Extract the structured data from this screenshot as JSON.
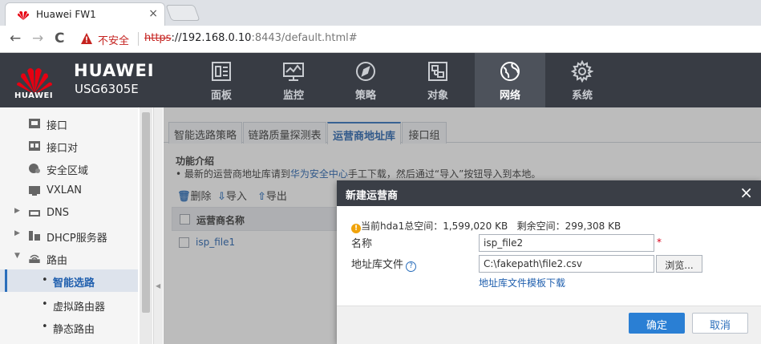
{
  "browser": {
    "tab_title": "Huawei FW1",
    "tab_close": "×",
    "back": "←",
    "forward": "→",
    "reload": "C",
    "insecure_label": "不安全",
    "url_scheme": "https",
    "url_host": "://192.168.0.10",
    "url_rest": ":8443/default.html#"
  },
  "header": {
    "logo_text": "HUAWEI",
    "brand": "HUAWEI",
    "model": "USG6305E",
    "nav": [
      {
        "label": "面板",
        "icon": "dashboard-icon"
      },
      {
        "label": "监控",
        "icon": "monitor-icon"
      },
      {
        "label": "策略",
        "icon": "compass-icon"
      },
      {
        "label": "对象",
        "icon": "object-icon"
      },
      {
        "label": "网络",
        "icon": "globe-icon",
        "active": true
      },
      {
        "label": "系统",
        "icon": "gear-icon"
      }
    ]
  },
  "sidebar": {
    "items": [
      {
        "label": "接口"
      },
      {
        "label": "接口对"
      },
      {
        "label": "安全区域"
      },
      {
        "label": "VXLAN"
      },
      {
        "label": "DNS",
        "arrow": "▶"
      },
      {
        "label": "DHCP服务器",
        "arrow": "▶"
      },
      {
        "label": "路由",
        "arrow": "▼"
      },
      {
        "label": "智能选路",
        "bullet": "•",
        "selected": true
      },
      {
        "label": "虚拟路由器",
        "bullet": "•"
      },
      {
        "label": "静态路由",
        "bullet": "•"
      }
    ],
    "collapse_glyph": "◀"
  },
  "main": {
    "tabs": [
      "智能选路策略",
      "链路质量探测表",
      "运营商地址库",
      "接口组"
    ],
    "active_tab": 2,
    "intro_title": "功能介绍",
    "intro_prefix": "• 最新的运营商地址库请到",
    "intro_link": "华为安全中心",
    "intro_suffix": "手工下载，然后通过“导入”按钮导入到本地。",
    "toolbar": {
      "delete_label": "删除",
      "import_label": "导入",
      "export_label": "导出"
    },
    "table": {
      "header": "运营商名称",
      "rows": [
        "isp_file1"
      ]
    }
  },
  "dialog": {
    "title": "新建运营商",
    "close": "×",
    "space_total": "当前hda1总空间：1,599,020 KB",
    "space_free": "剩余空间：299,308 KB",
    "name_label": "名称",
    "name_value": "isp_file2",
    "required_mark": "*",
    "file_label": "地址库文件",
    "file_value": "C:\\fakepath\\file2.csv",
    "browse_label": "浏览...",
    "template_link": "地址库文件模板下载",
    "ok_label": "确定",
    "cancel_label": "取消"
  },
  "colors": {
    "header_bg": "#383c44",
    "accent": "#2a7fd4",
    "link": "#1f5fae",
    "danger": "#c5221f"
  }
}
